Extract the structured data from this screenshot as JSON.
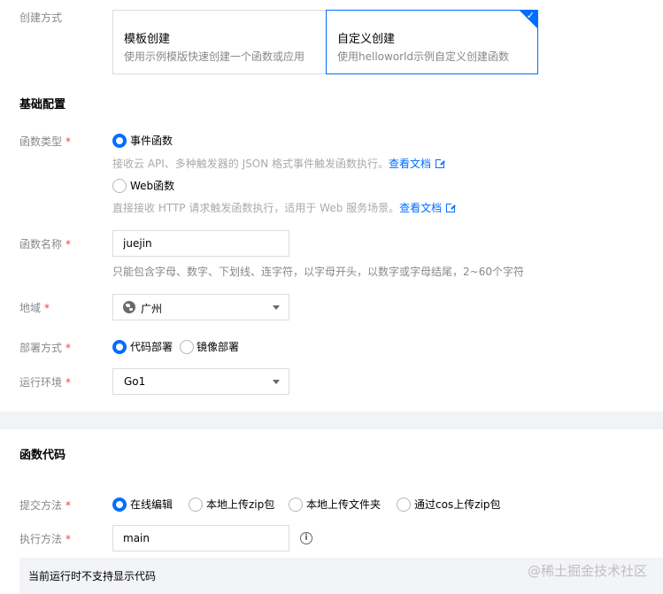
{
  "create_method": {
    "label": "创建方式",
    "options": [
      {
        "title": "模板创建",
        "desc": "使用示例模版快速创建一个函数或应用",
        "selected": false
      },
      {
        "title": "自定义创建",
        "desc": "使用helloworld示例自定义创建函数",
        "selected": true
      }
    ]
  },
  "basic": {
    "title": "基础配置",
    "func_type": {
      "label": "函数类型",
      "required": "*",
      "options": [
        {
          "label": "事件函数",
          "desc": "接收云 API、多种触发器的 JSON 格式事件触发函数执行。",
          "link": "查看文档",
          "selected": true
        },
        {
          "label": "Web函数",
          "desc": "直接接收 HTTP 请求触发函数执行，适用于 Web 服务场景。",
          "link": "查看文档",
          "selected": false
        }
      ]
    },
    "func_name": {
      "label": "函数名称",
      "required": "*",
      "value": "juejin",
      "hint": "只能包含字母、数字、下划线、连字符，以字母开头，以数字或字母结尾，2~60个字符"
    },
    "region": {
      "label": "地域",
      "required": "*",
      "value": "广州"
    },
    "deploy": {
      "label": "部署方式",
      "required": "*",
      "options": [
        {
          "label": "代码部署",
          "selected": true
        },
        {
          "label": "镜像部署",
          "selected": false
        }
      ]
    },
    "runtime": {
      "label": "运行环境",
      "required": "*",
      "value": "Go1"
    }
  },
  "code": {
    "title": "函数代码",
    "submit": {
      "label": "提交方法",
      "required": "*",
      "options": [
        {
          "label": "在线编辑",
          "selected": true
        },
        {
          "label": "本地上传zip包",
          "selected": false
        },
        {
          "label": "本地上传文件夹",
          "selected": false
        },
        {
          "label": "通过cos上传zip包",
          "selected": false
        }
      ]
    },
    "handler": {
      "label": "执行方法",
      "required": "*",
      "value": "main"
    },
    "notice": "当前运行时不支持显示代码"
  },
  "watermark": "@稀土掘金技术社区",
  "colors": {
    "accent": "#006eff",
    "required": "#e54545",
    "page_bg": "#f2f3f5"
  },
  "icons": {
    "selected_corner": "check-icon",
    "region": "globe-icon",
    "doc_link": "external-link-icon",
    "handler_help": "info-icon"
  }
}
